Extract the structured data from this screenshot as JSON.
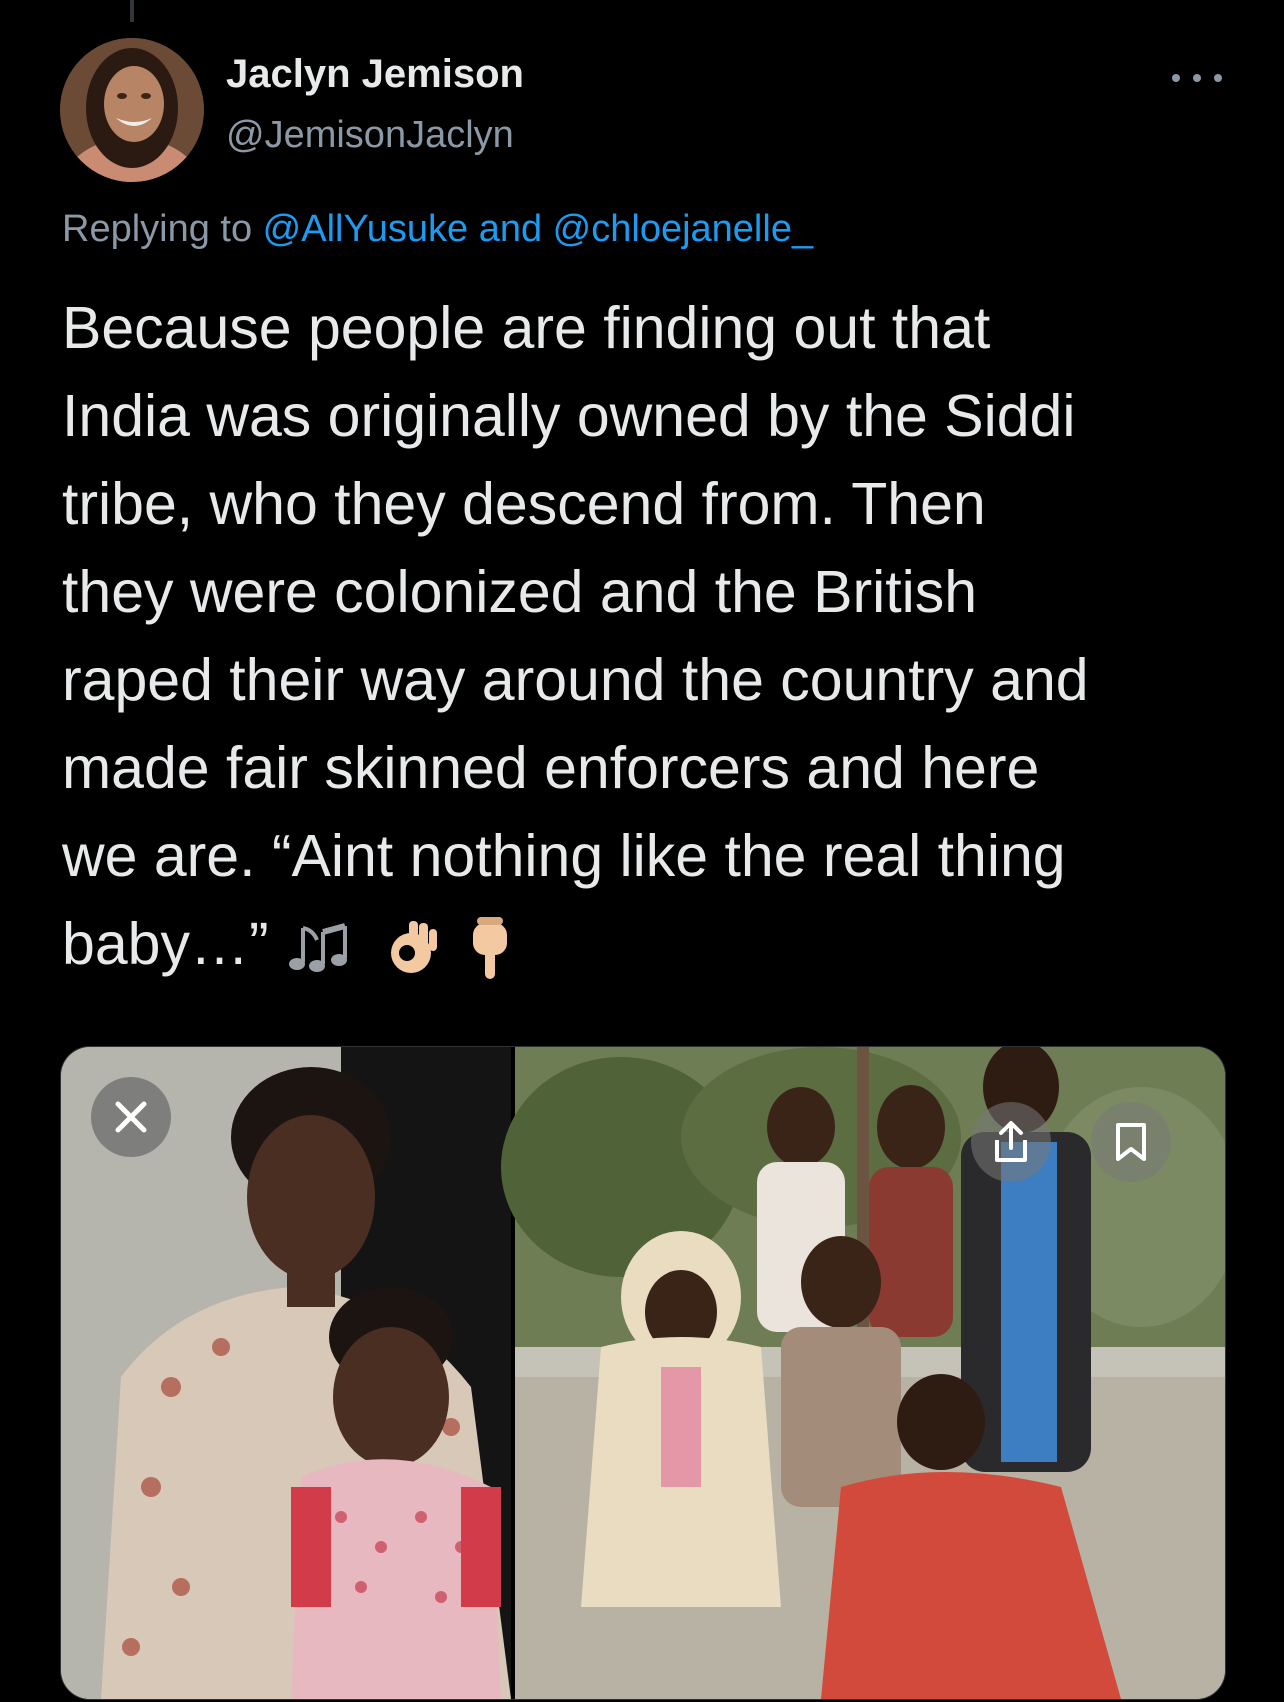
{
  "tweet": {
    "author_name": "Jaclyn Jemison",
    "author_handle": "@JemisonJaclyn",
    "reply_prefix": "Replying to ",
    "reply_user_1": "@AllYusuke",
    "reply_conjunction": " and ",
    "reply_user_2": "@chloejanelle_",
    "text_lines": [
      "Because people are finding out that",
      "India was originally owned by the Siddi",
      "tribe, who they descend from. Then",
      "they were colonized and the British",
      "raped their way around the country and",
      "made fair skinned enforcers and here",
      "we are. “Aint nothing like the real thing",
      "baby…”"
    ],
    "emojis": [
      "music-notes-icon",
      "ok-hand-icon",
      "point-down-icon"
    ]
  },
  "media": {
    "photo_count": 2,
    "controls": [
      "close-icon",
      "share-icon",
      "bookmark-icon"
    ]
  },
  "colors": {
    "background": "#000000",
    "text": "#e7e9ea",
    "secondary_text": "#8b98a5",
    "link": "#1d9bf0"
  }
}
